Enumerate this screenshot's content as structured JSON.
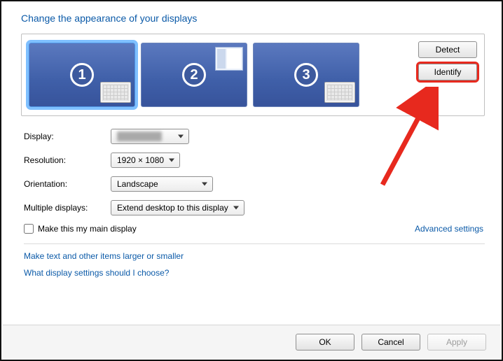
{
  "title": "Change the appearance of your displays",
  "monitors": [
    {
      "id": "1",
      "selected": true,
      "decor": "keyboard"
    },
    {
      "id": "2",
      "selected": false,
      "decor": "window"
    },
    {
      "id": "3",
      "selected": false,
      "decor": "keyboard"
    }
  ],
  "panel_buttons": {
    "detect": "Detect",
    "identify": "Identify"
  },
  "fields": {
    "display_label": "Display:",
    "display_value": "",
    "resolution_label": "Resolution:",
    "resolution_value": "1920 × 1080",
    "orientation_label": "Orientation:",
    "orientation_value": "Landscape",
    "multiple_label": "Multiple displays:",
    "multiple_value": "Extend desktop to this display"
  },
  "main_display": {
    "checkbox_label": "Make this my main display",
    "checked": false
  },
  "adv_link": "Advanced settings",
  "links": {
    "items_larger": "Make text and other items larger or smaller",
    "help": "What display settings should I choose?"
  },
  "buttons": {
    "ok": "OK",
    "cancel": "Cancel",
    "apply": "Apply"
  },
  "highlight": {
    "identify": true
  }
}
